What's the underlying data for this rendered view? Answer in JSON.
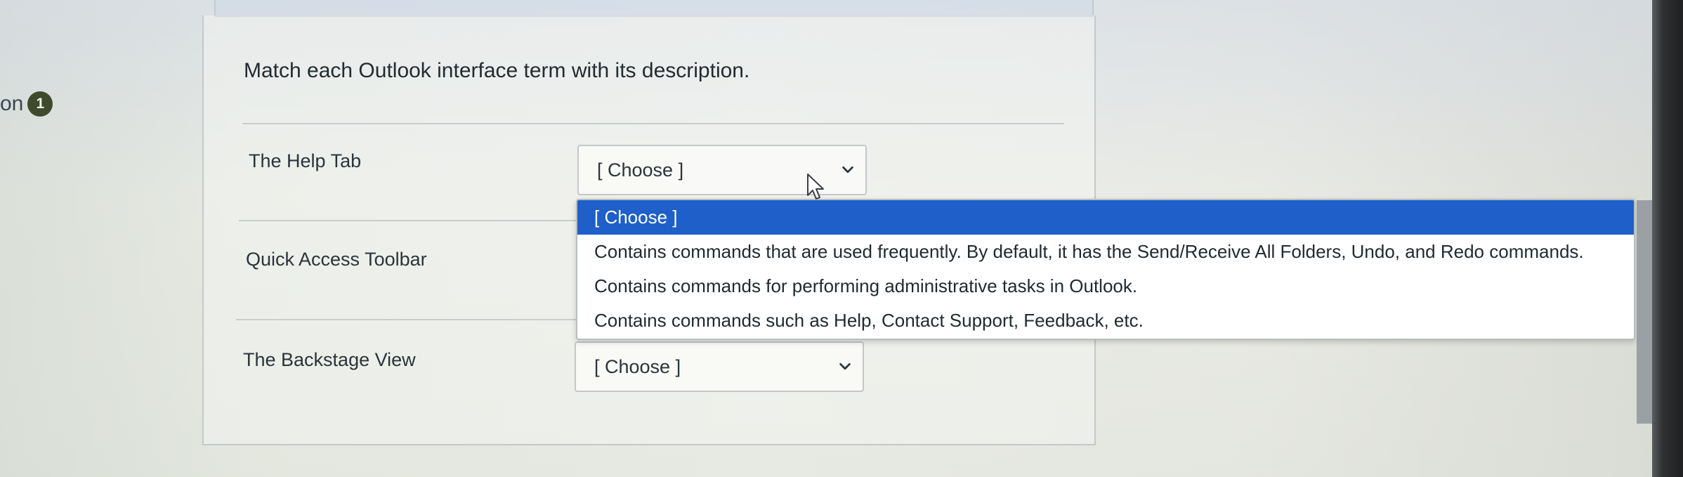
{
  "question": {
    "label": "on",
    "number": "1",
    "prompt": "Match each Outlook interface term with its description."
  },
  "items": [
    {
      "term": "The Help Tab",
      "selected": "[ Choose ]"
    },
    {
      "term": "Quick Access Toolbar"
    },
    {
      "term": "The Backstage View",
      "selected": "[ Choose ]"
    }
  ],
  "dropdown": {
    "options": [
      "[ Choose ]",
      "Contains commands that are used frequently. By default, it has the Send/Receive All Folders, Undo, and Redo commands.",
      "Contains commands for performing administrative tasks in Outlook.",
      "Contains commands such as Help, Contact Support, Feedback, etc."
    ],
    "highlighted_index": 0,
    "highlight_color": "#1e5fc9"
  },
  "icons": {
    "select_arrow": "chevron-down-icon",
    "pointer": "mouse-pointer-icon"
  }
}
